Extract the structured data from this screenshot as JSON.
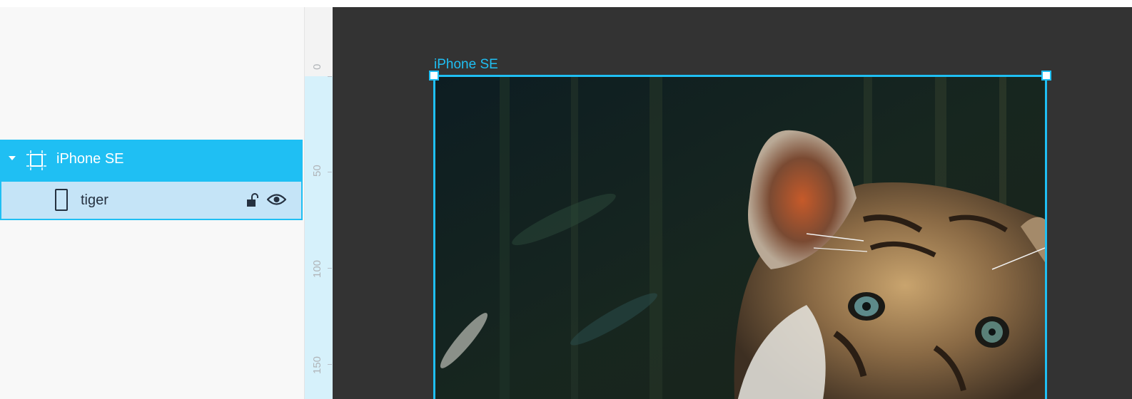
{
  "layers": {
    "artboard": {
      "label": "iPhone SE"
    },
    "children": [
      {
        "label": "tiger",
        "locked": false,
        "visible": true
      }
    ]
  },
  "ruler": {
    "labels": [
      "0",
      "50",
      "100",
      "150"
    ]
  },
  "canvas": {
    "artboard_title": "iPhone SE",
    "image_name": "tiger"
  },
  "colors": {
    "accent": "#1fbff3",
    "selection_light": "#c5e4f7",
    "canvas_bg": "#333333",
    "panel_bg": "#f8f8f8",
    "text_dark": "#253140"
  },
  "icons": [
    "caret-down-icon",
    "artboard-icon",
    "phone-icon",
    "unlock-icon",
    "eye-icon"
  ]
}
